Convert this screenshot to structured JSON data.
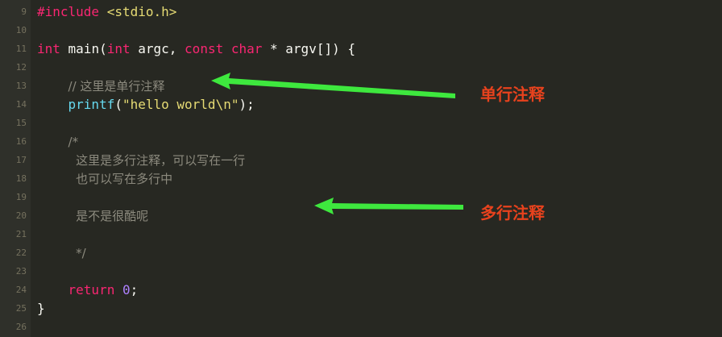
{
  "lines": [
    {
      "number": "9",
      "tokens": [
        {
          "t": "#include ",
          "c": "pp"
        },
        {
          "t": "<stdio.h>",
          "c": "str"
        }
      ]
    },
    {
      "number": "10",
      "tokens": []
    },
    {
      "number": "11",
      "tokens": [
        {
          "t": "int",
          "c": "kw"
        },
        {
          "t": " main(",
          "c": "plain"
        },
        {
          "t": "int",
          "c": "kw"
        },
        {
          "t": " argc, ",
          "c": "plain"
        },
        {
          "t": "const",
          "c": "kw"
        },
        {
          "t": " ",
          "c": "plain"
        },
        {
          "t": "char",
          "c": "kw"
        },
        {
          "t": " * argv[]) {",
          "c": "plain"
        }
      ]
    },
    {
      "number": "12",
      "tokens": []
    },
    {
      "number": "13",
      "tokens": [
        {
          "t": "    ",
          "c": "plain"
        },
        {
          "t": "// 这里是单行注释",
          "c": "comment"
        }
      ]
    },
    {
      "number": "14",
      "tokens": [
        {
          "t": "    ",
          "c": "plain"
        },
        {
          "t": "printf",
          "c": "fn"
        },
        {
          "t": "(",
          "c": "plain"
        },
        {
          "t": "\"hello world\\n\"",
          "c": "str"
        },
        {
          "t": ");",
          "c": "plain"
        }
      ]
    },
    {
      "number": "15",
      "tokens": []
    },
    {
      "number": "16",
      "tokens": [
        {
          "t": "    ",
          "c": "plain"
        },
        {
          "t": "/*",
          "c": "comment"
        }
      ]
    },
    {
      "number": "17",
      "tokens": [
        {
          "t": "     ",
          "c": "plain"
        },
        {
          "t": "这里是多行注释，可以写在一行",
          "c": "comment"
        }
      ]
    },
    {
      "number": "18",
      "tokens": [
        {
          "t": "     ",
          "c": "plain"
        },
        {
          "t": "也可以写在多行中",
          "c": "comment"
        }
      ]
    },
    {
      "number": "19",
      "tokens": []
    },
    {
      "number": "20",
      "tokens": [
        {
          "t": "     ",
          "c": "plain"
        },
        {
          "t": "是不是很酷呢",
          "c": "comment"
        }
      ]
    },
    {
      "number": "21",
      "tokens": []
    },
    {
      "number": "22",
      "tokens": [
        {
          "t": "     ",
          "c": "plain"
        },
        {
          "t": "*/",
          "c": "comment"
        }
      ]
    },
    {
      "number": "23",
      "tokens": []
    },
    {
      "number": "24",
      "tokens": [
        {
          "t": "    ",
          "c": "plain"
        },
        {
          "t": "return",
          "c": "kw"
        },
        {
          "t": " ",
          "c": "plain"
        },
        {
          "t": "0",
          "c": "num"
        },
        {
          "t": ";",
          "c": "plain"
        }
      ]
    },
    {
      "number": "25",
      "tokens": [
        {
          "t": "}",
          "c": "plain"
        }
      ]
    },
    {
      "number": "26",
      "tokens": []
    }
  ],
  "annotations": {
    "single_line_label": "单行注释",
    "multi_line_label": "多行注释"
  },
  "colors": {
    "background": "#272822",
    "keyword": "#f92672",
    "function": "#66d9ef",
    "string": "#e6db74",
    "number": "#ae81ff",
    "comment": "#8c8a7e",
    "arrow": "#3ee83e",
    "annotation_text": "#e8421d"
  }
}
